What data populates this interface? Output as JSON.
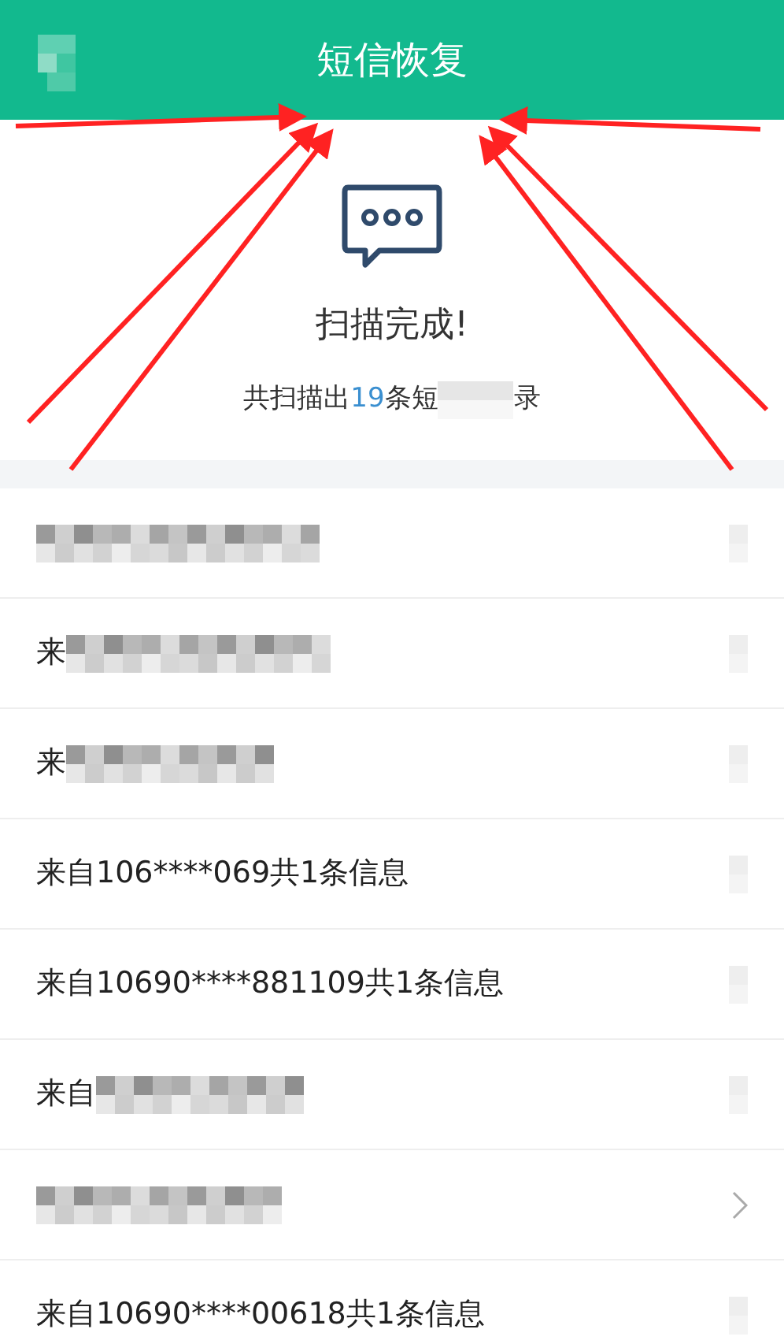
{
  "header": {
    "title": "短信恢复",
    "back_redacted": true
  },
  "scan": {
    "title": "扫描完成!",
    "summary_prefix": "共扫描出",
    "count": "19",
    "summary_middle": "条短",
    "summary_redacted": true,
    "summary_suffix": "录"
  },
  "rows": [
    {
      "redacted": true,
      "chevron": false
    },
    {
      "text": "来",
      "redacted": true,
      "chevron": false
    },
    {
      "text": "来",
      "redacted": true,
      "chevron": false
    },
    {
      "text": "来自106****069共1条信息",
      "redacted": false,
      "chevron": false
    },
    {
      "text": "来自10690****881109共1条信息",
      "redacted": false,
      "chevron": false
    },
    {
      "text": "来自",
      "redacted": true,
      "chevron": false
    },
    {
      "redacted": true,
      "chevron": true
    },
    {
      "text": "来自10690****00618共1条信息",
      "redacted": false,
      "chevron": false
    }
  ]
}
